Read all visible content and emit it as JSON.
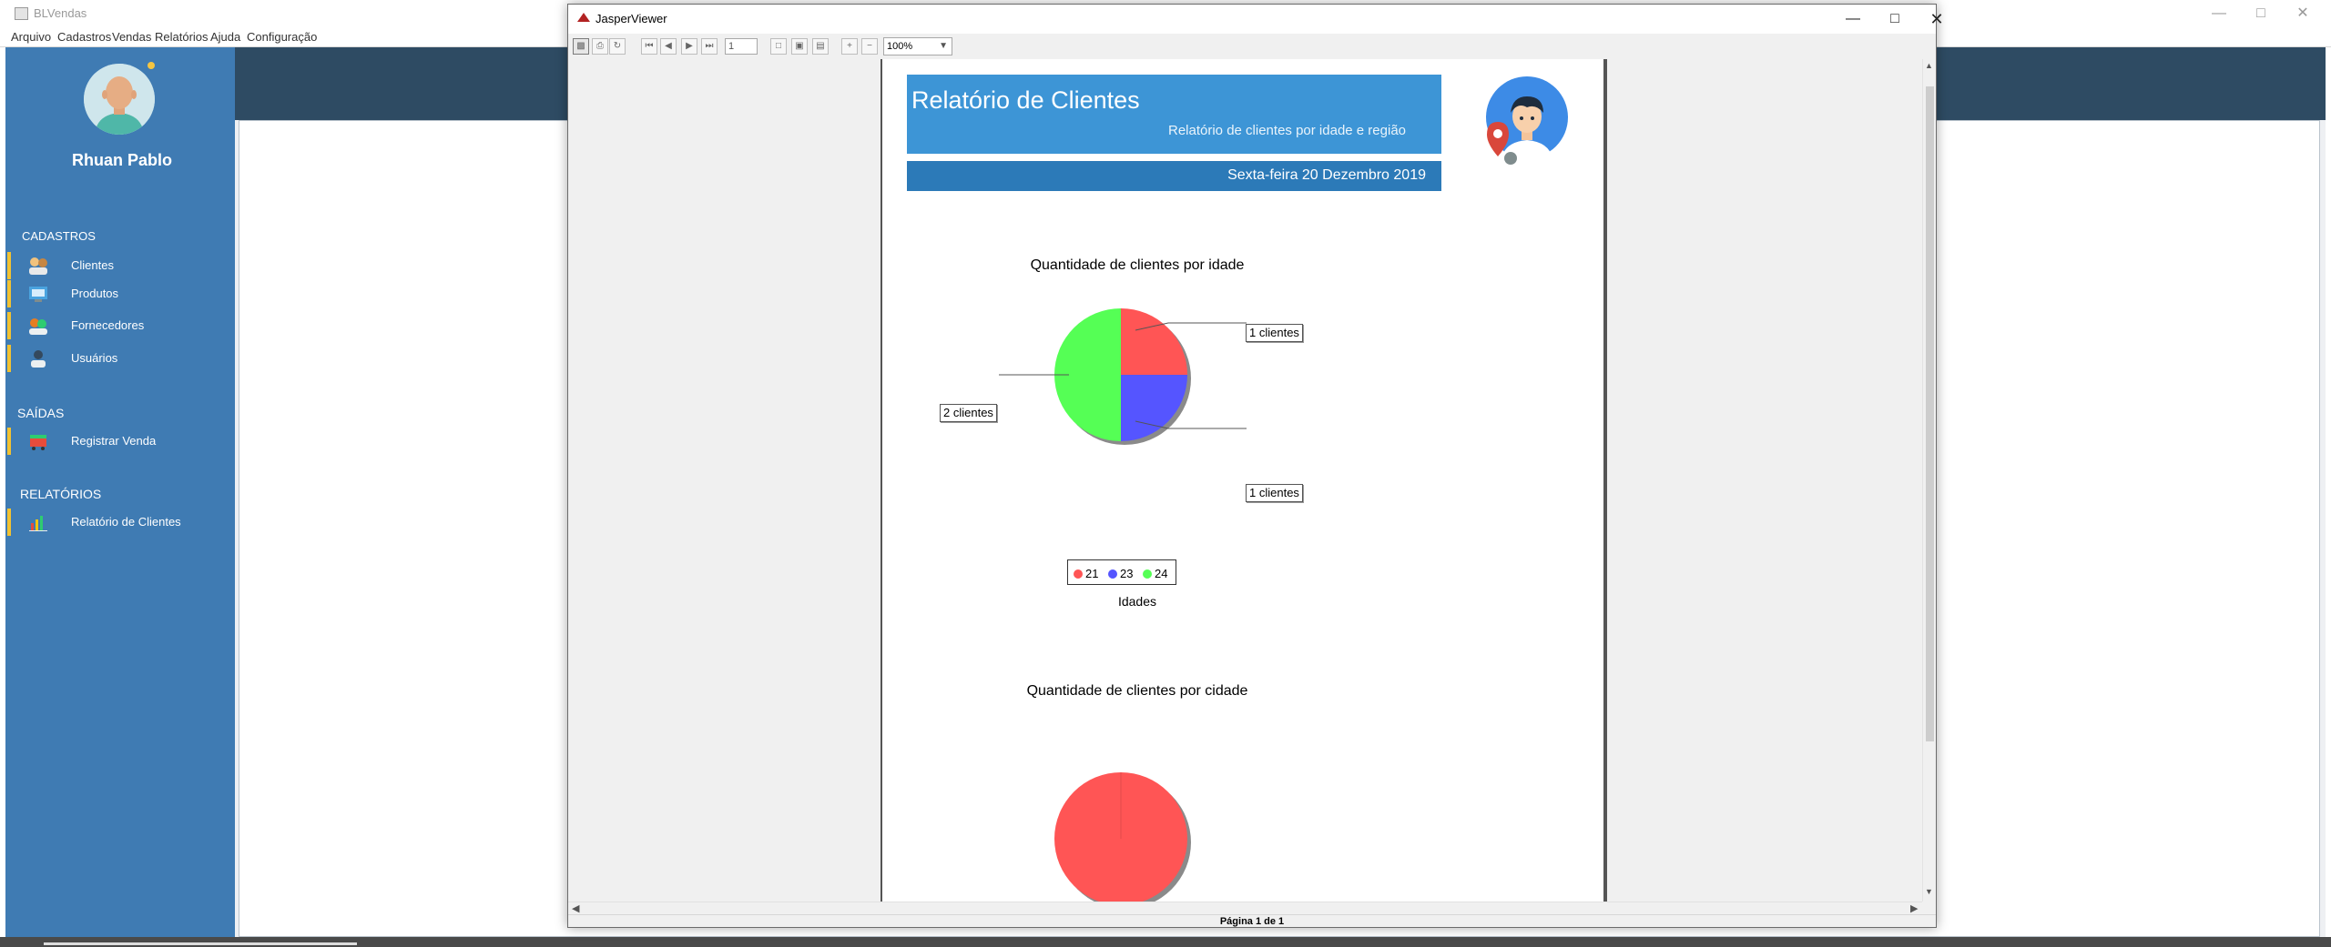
{
  "app": {
    "title": "BLVendas",
    "menu": [
      "Arquivo",
      "Cadastros",
      "Vendas",
      "Relatórios",
      "Ajuda",
      "Configuração"
    ]
  },
  "sidebar": {
    "user_name": "Rhuan Pablo",
    "sections": {
      "cadastros": "CADASTROS",
      "saidas": "SAÍDAS",
      "relatorios": "RELATÓRIOS"
    },
    "items": [
      {
        "label": "Clientes",
        "icon": "customers-icon"
      },
      {
        "label": "Produtos",
        "icon": "products-icon"
      },
      {
        "label": "Fornecedores",
        "icon": "suppliers-icon"
      },
      {
        "label": "Usuários",
        "icon": "users-icon"
      },
      {
        "label": "Registrar Venda",
        "icon": "cart-icon"
      },
      {
        "label": "Relatório de Clientes",
        "icon": "report-chart-icon"
      }
    ],
    "accent_color": "#f2c230",
    "background_color": "#3f7bb3"
  },
  "viewer": {
    "title": "JasperViewer",
    "page_number": "1",
    "zoom": "100%",
    "status": "Página 1 de 1"
  },
  "report": {
    "title": "Relatório de Clientes",
    "subtitle": "Relatório de clientes por idade e região",
    "date": "Sexta-feira 20 Dezembro 2019",
    "chart_age": {
      "title": "Quantidade de clientes por idade",
      "axis_label": "Idades",
      "callout_top_right": "1 clientes",
      "callout_bottom_right": "1 clientes",
      "callout_left": "2 clientes"
    },
    "chart_city": {
      "title": "Quantidade de clientes por cidade"
    }
  },
  "chart_data": [
    {
      "type": "pie",
      "title": "Quantidade de clientes por idade",
      "xlabel": "Idades",
      "categories": [
        "21",
        "23",
        "24"
      ],
      "values": [
        1,
        1,
        2
      ],
      "colors": [
        "#ff5555",
        "#5555ff",
        "#55ff55"
      ],
      "value_labels": [
        "1 clientes",
        "1 clientes",
        "2 clientes"
      ],
      "legend": "bottom"
    },
    {
      "type": "pie",
      "title": "Quantidade de clientes por cidade",
      "categories": [],
      "values": [
        1
      ],
      "colors": [
        "#ff5555"
      ]
    }
  ]
}
